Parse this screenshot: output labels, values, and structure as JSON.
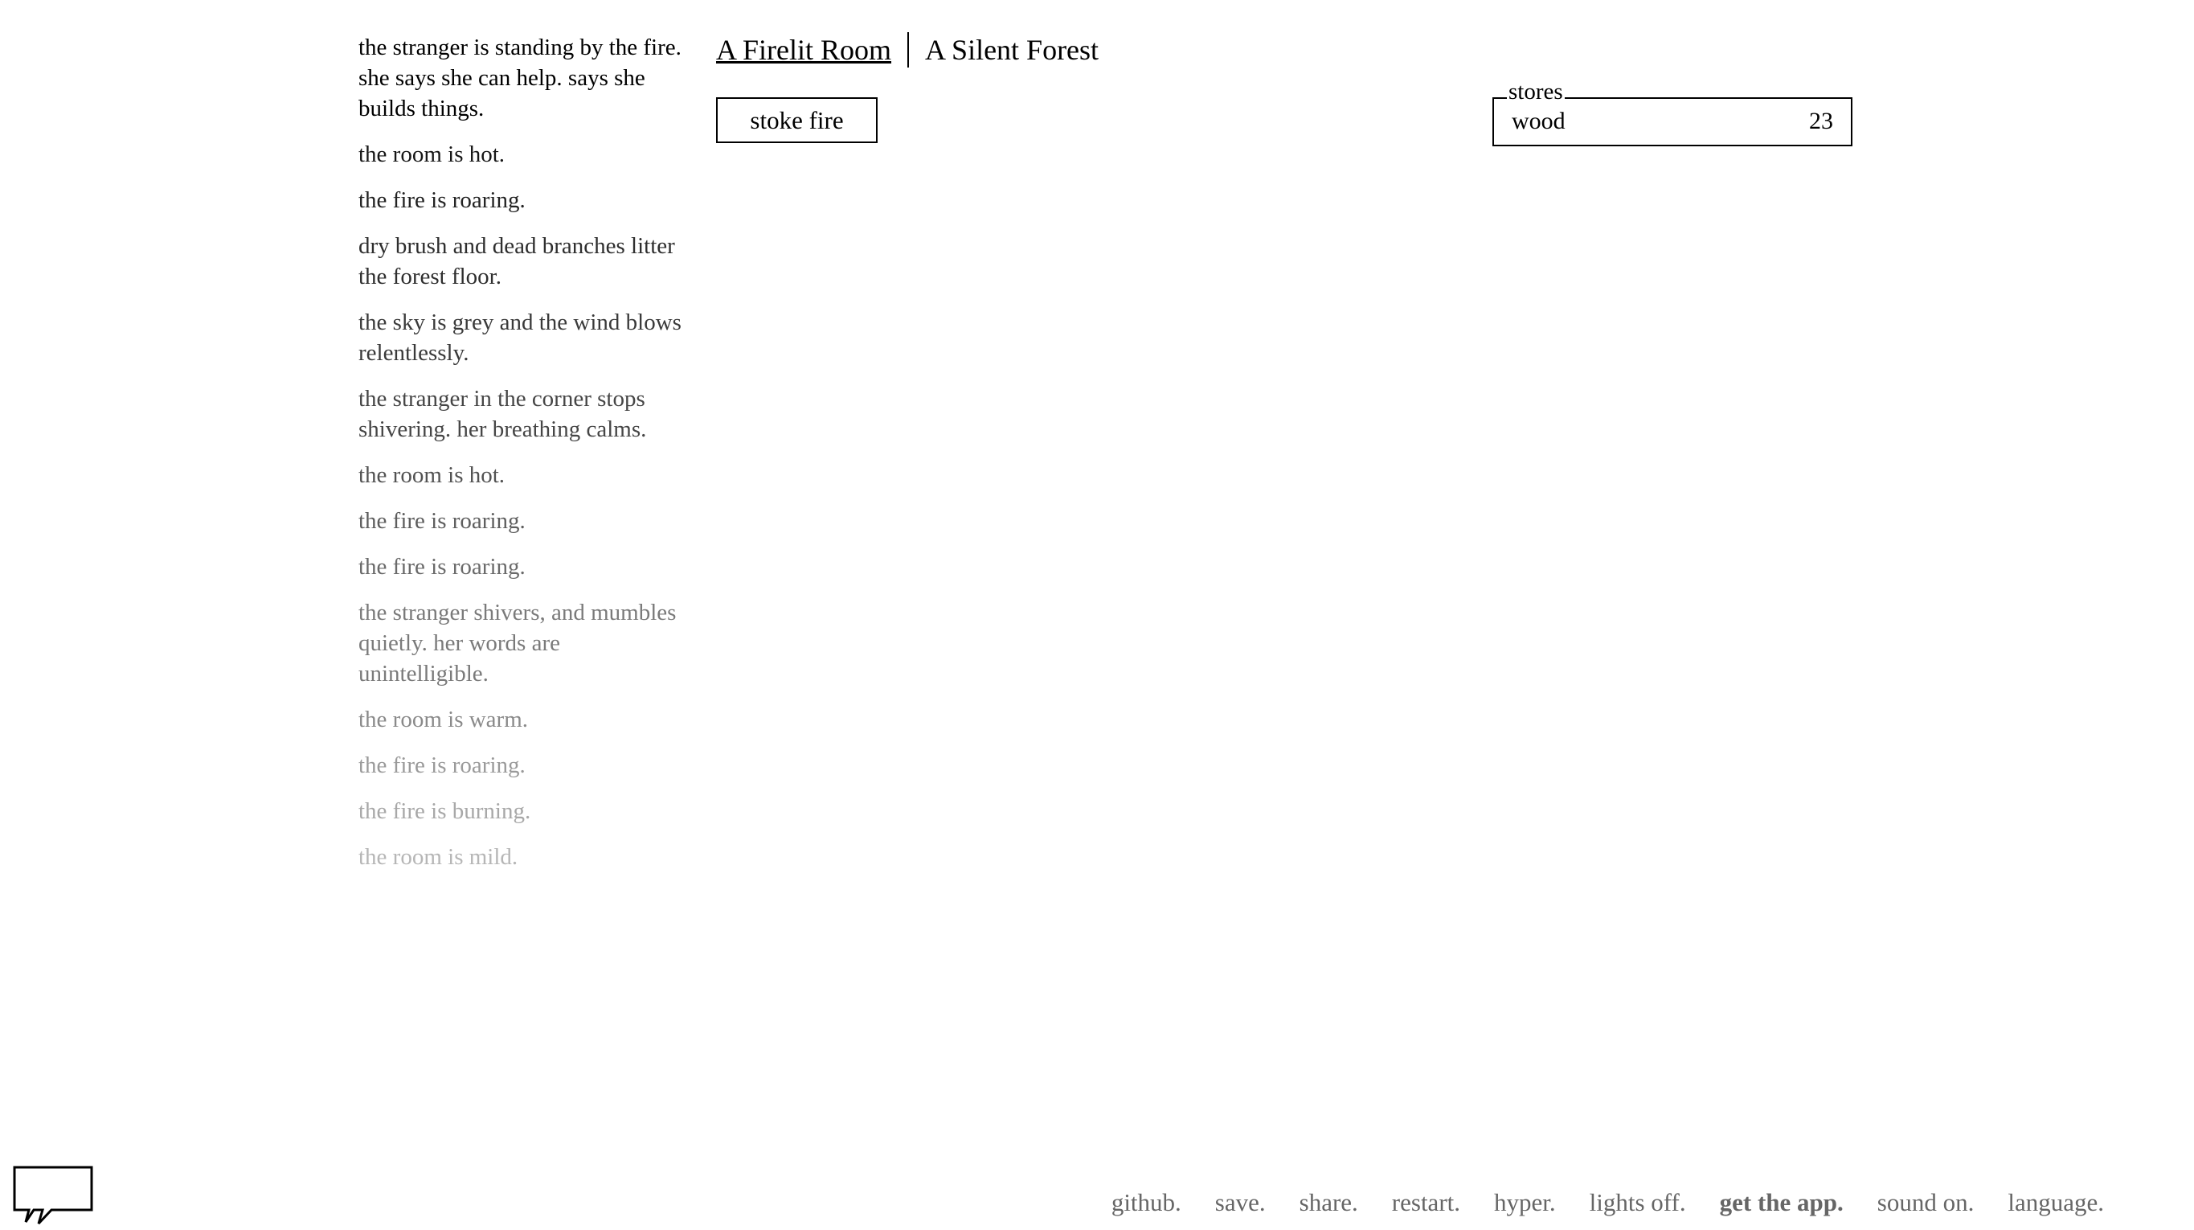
{
  "notifications": [
    {
      "text": "the stranger is standing by the fire. she says she can help. says she builds things.",
      "color": "#000000"
    },
    {
      "text": "the room is hot.",
      "color": "#161616"
    },
    {
      "text": "the fire is roaring.",
      "color": "#222222"
    },
    {
      "text": "dry brush and dead branches litter the forest floor.",
      "color": "#2e2e2e"
    },
    {
      "text": "the sky is grey and the wind blows relentlessly.",
      "color": "#3a3a3a"
    },
    {
      "text": "the stranger in the corner stops shivering. her breathing calms.",
      "color": "#464646"
    },
    {
      "text": "the room is hot.",
      "color": "#525252"
    },
    {
      "text": "the fire is roaring.",
      "color": "#5e5e5e"
    },
    {
      "text": "the fire is roaring.",
      "color": "#6a6a6a"
    },
    {
      "text": "the stranger shivers, and mumbles quietly. her words are unintelligible.",
      "color": "#7a7a7a"
    },
    {
      "text": "the room is warm.",
      "color": "#8a8a8a"
    },
    {
      "text": "the fire is roaring.",
      "color": "#9a9a9a"
    },
    {
      "text": "the fire is burning.",
      "color": "#a8a8a8"
    },
    {
      "text": "the room is mild.",
      "color": "#b6b6b6"
    }
  ],
  "header": {
    "locations": [
      "A Firelit Room",
      "A Silent Forest"
    ],
    "selected": 0
  },
  "actions": {
    "stoke_fire": "stoke fire"
  },
  "stores": {
    "legend": "stores",
    "items": [
      {
        "name": "wood",
        "count": "23"
      }
    ]
  },
  "menu": {
    "items": [
      {
        "label": "github.",
        "bold": false
      },
      {
        "label": "save.",
        "bold": false
      },
      {
        "label": "share.",
        "bold": false
      },
      {
        "label": "restart.",
        "bold": false
      },
      {
        "label": "hyper.",
        "bold": false
      },
      {
        "label": "lights off.",
        "bold": false
      },
      {
        "label": "get the app.",
        "bold": true
      },
      {
        "label": "sound on.",
        "bold": false
      },
      {
        "label": "language.",
        "bold": false
      }
    ]
  },
  "icons": {
    "feedback": "speech-bubble-icon"
  }
}
